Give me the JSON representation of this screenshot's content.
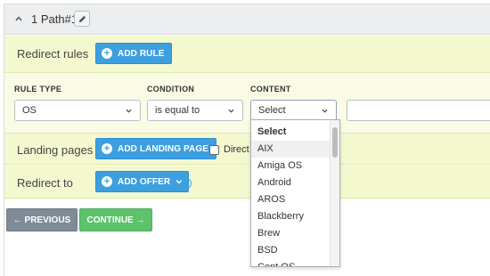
{
  "path": {
    "title": "1 Path#1"
  },
  "redirect_rules": {
    "label": "Redirect rules",
    "add_button": "ADD RULE"
  },
  "columns": {
    "rule_type": "RULE TYPE",
    "condition": "CONDITION",
    "content": "CONTENT"
  },
  "rule": {
    "type_value": "OS",
    "condition_value": "is equal to",
    "content_value": "Select"
  },
  "dropdown": {
    "options": [
      "Select",
      "AIX",
      "Amiga OS",
      "Android",
      "AROS",
      "Blackberry",
      "Brew",
      "BSD",
      "Cent OS"
    ],
    "highlighted": "AIX"
  },
  "landing_pages": {
    "label": "Landing pages",
    "add_button": "ADD LANDING PAGE",
    "checkbox_label": "Direct li"
  },
  "redirect_to": {
    "label": "Redirect to",
    "add_button": "ADD OFFER",
    "help": "?"
  },
  "nav": {
    "previous": "← PREVIOUS",
    "continue": "CONTINUE →"
  },
  "colors": {
    "accent_blue": "#3c9fe0",
    "continue_green": "#5cc36b",
    "previous_gray": "#7f8c97",
    "panel_yellow": "#f4f8cf"
  }
}
